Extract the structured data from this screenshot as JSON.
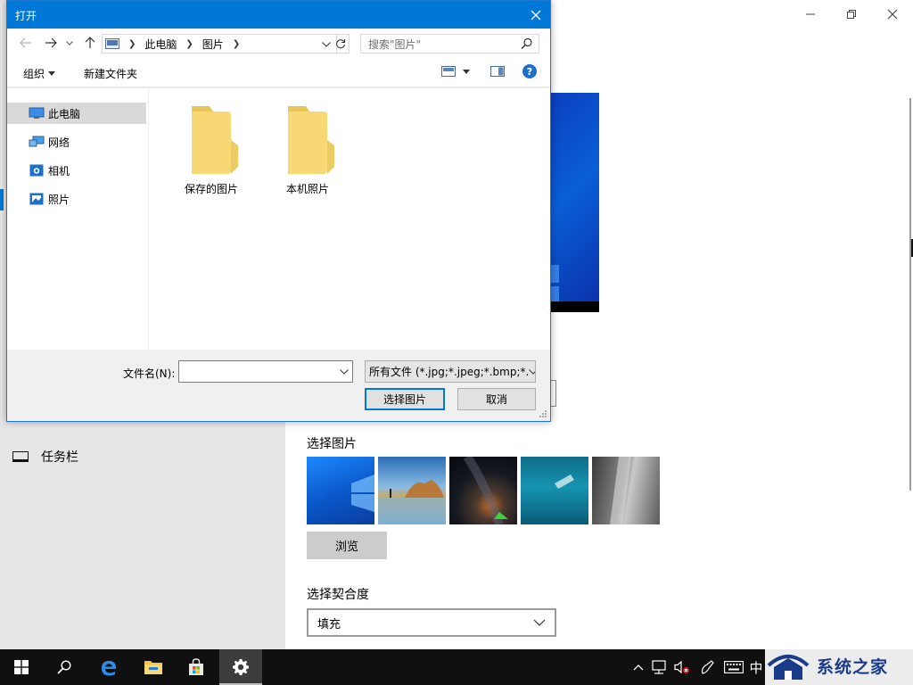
{
  "settings": {
    "nav_taskbar_label": "任务栏",
    "choose_picture_label": "选择图片",
    "browse_label": "浏览",
    "fit_label": "选择契合度",
    "fit_value": "填充"
  },
  "dialog": {
    "title": "打开",
    "breadcrumb": [
      "此电脑",
      "图片"
    ],
    "search_placeholder": "搜索\"图片\"",
    "toolbar": {
      "organize_label": "组织",
      "new_folder_label": "新建文件夹",
      "help_label": "?"
    },
    "nav_items": [
      {
        "label": "此电脑",
        "icon": "computer-icon",
        "selected": true
      },
      {
        "label": "网络",
        "icon": "network-icon",
        "selected": false
      },
      {
        "label": "相机",
        "icon": "camera-icon",
        "selected": false
      },
      {
        "label": "照片",
        "icon": "photos-icon",
        "selected": false
      }
    ],
    "folders": [
      {
        "label": "保存的图片",
        "icon": "folder-icon"
      },
      {
        "label": "本机照片",
        "icon": "folder-icon"
      }
    ],
    "filename_label": "文件名(N):",
    "filename_value": "",
    "filetype_value": "所有文件 (*.jpg;*.jpeg;*.bmp;*.",
    "open_button_label": "选择图片",
    "cancel_button_label": "取消"
  },
  "taskbar": {
    "ime_indicator": "中"
  },
  "watermark": {
    "text": "系统之家"
  },
  "colors": {
    "accent": "#0078d7",
    "taskbar": "#101010",
    "folder": "#f8d775"
  }
}
